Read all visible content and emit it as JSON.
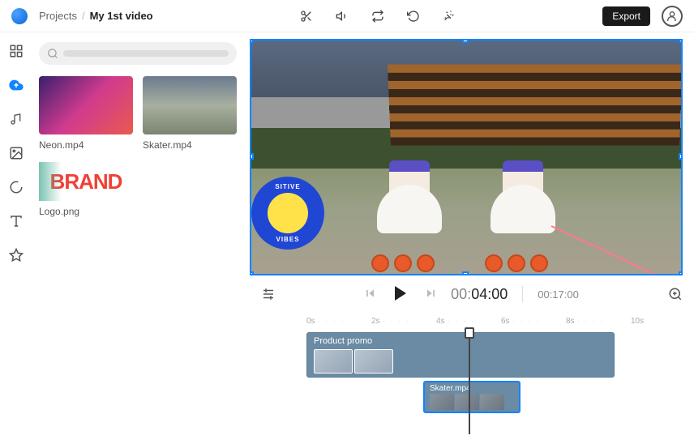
{
  "breadcrumb": {
    "root": "Projects",
    "current": "My 1st video"
  },
  "topbar": {
    "export_label": "Export"
  },
  "media": {
    "items": [
      {
        "label": "Neon.mp4"
      },
      {
        "label": "Skater.mp4"
      }
    ],
    "logo": {
      "label": "Logo.png",
      "brand_text": "BRAND"
    }
  },
  "sticker": {
    "top_text": "SITIVE",
    "bottom_text": "VIBES"
  },
  "timeline": {
    "current_prefix": "00:",
    "current_main": "04:00",
    "total": "00:17:00",
    "ruler": [
      "0s",
      "2s",
      "4s",
      "6s",
      "8s",
      "10s"
    ],
    "clip1_label": "Product promo",
    "clip2_label": "Skater.mp4"
  }
}
